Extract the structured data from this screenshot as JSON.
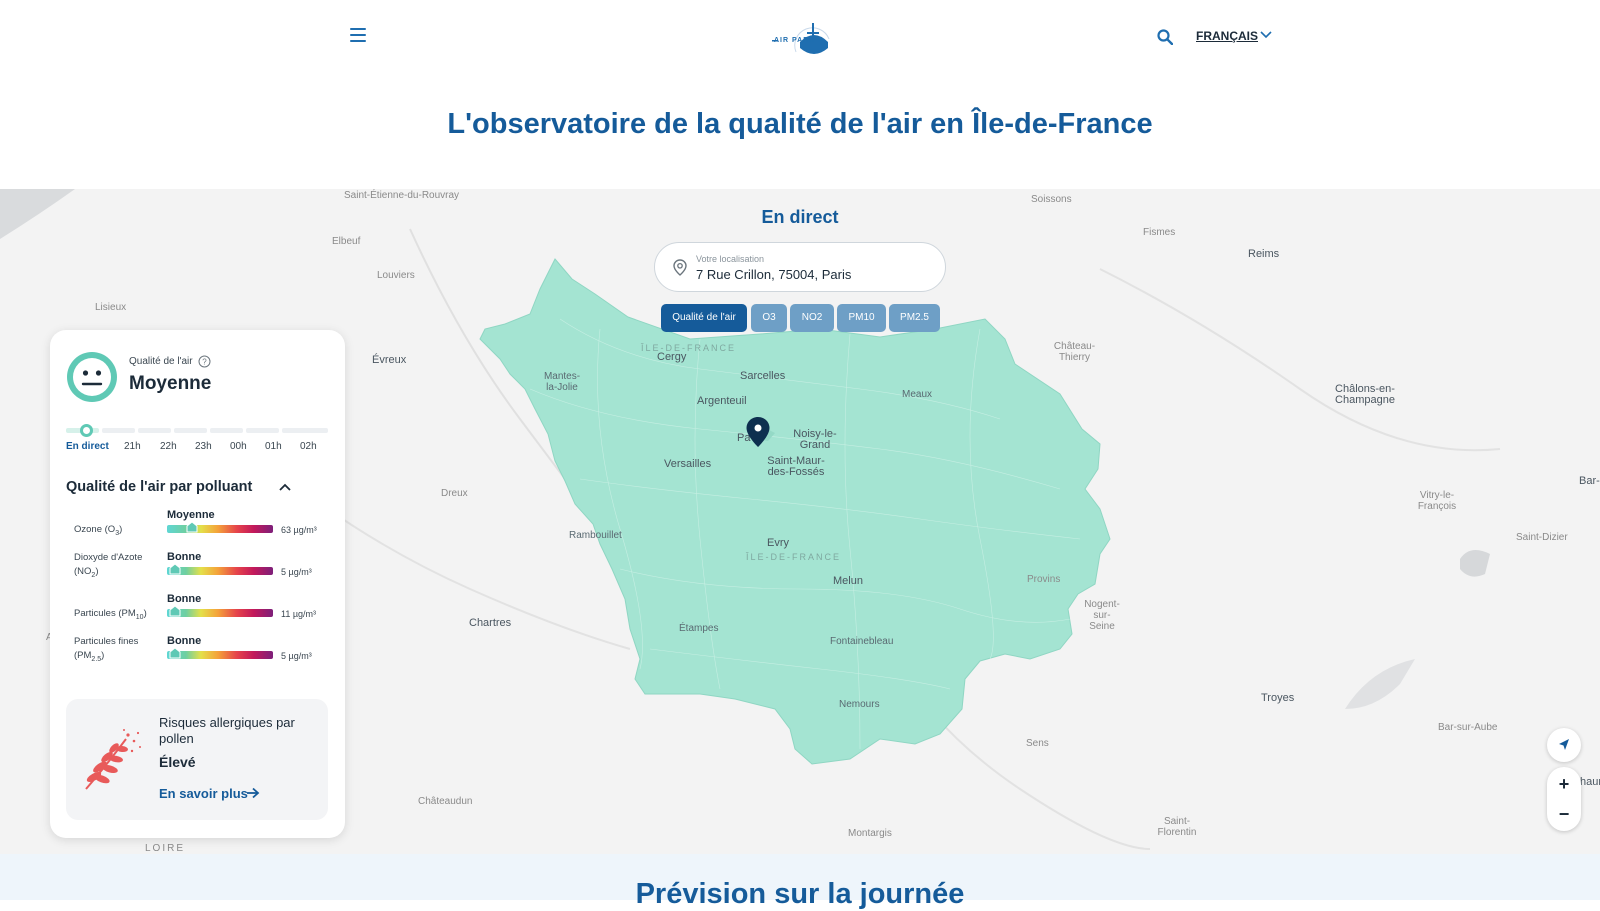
{
  "header": {
    "menu_icon": "hamburger-icon",
    "logo_text": "AIR PARIF",
    "search_icon": "search-icon",
    "language": "FRANÇAIS"
  },
  "page_title": "L'observatoire de la qualité de l'air en Île-de-France",
  "map": {
    "title": "En direct",
    "location": {
      "label": "Votre localisation",
      "value": "7 Rue Crillon, 75004, Paris"
    },
    "tabs": [
      {
        "label": "Qualité de l'air",
        "active": true
      },
      {
        "label": "O3",
        "active": false
      },
      {
        "label": "NO2",
        "active": false
      },
      {
        "label": "PM10",
        "active": false
      },
      {
        "label": "PM2.5",
        "active": false
      }
    ],
    "fill_color": "#9fe3d0",
    "marker_color": "#0d2f4f",
    "cities": [
      "Saint-Étienne-du-Rouvray",
      "Elbeuf",
      "Louviers",
      "Lisieux",
      "Évreux",
      "Dreux",
      "Chartres",
      "Châteaudun",
      "Soissons",
      "Fismes",
      "Reims",
      "Château-Thierry",
      "Châlons-en-Champagne",
      "Vitry-le-François",
      "Saint-Dizier",
      "Bar-",
      "Troyes",
      "Bar-sur-Aube",
      "Sens",
      "Montargis",
      "Saint-Florentin",
      "Nogent-sur-Seine",
      "Provins",
      "Mantes-la-Jolie",
      "Cergy",
      "Sarcelles",
      "Argenteuil",
      "Meaux",
      "Pa",
      "Noisy-le-Grand",
      "Versailles",
      "Saint-Maur-des-Fossés",
      "Rambouillet",
      "Evry",
      "Melun",
      "Étampes",
      "Fontainebleau",
      "Nemours",
      "LOIRE",
      "A",
      "haum"
    ],
    "region_labels": [
      "ÎLE-DE-FRANCE",
      "ÎLE-DE-FRANCE"
    ],
    "controls": {
      "geolocate_icon": "navigation-arrow-icon",
      "zoom_in": "+",
      "zoom_out": "−"
    }
  },
  "card": {
    "aq_label": "Qualité de l'air",
    "aq_value": "Moyenne",
    "face_icon": "neutral-face-icon",
    "face_color": "#5fc9b5",
    "timeline": [
      "En direct",
      "21h",
      "22h",
      "23h",
      "00h",
      "01h",
      "02h"
    ],
    "pollutants_header": "Qualité de l'air par polluant",
    "pollutants": [
      {
        "name": "Ozone (O",
        "sub": "3",
        "name_after": ")",
        "level": "Moyenne",
        "value": "63 µg/m³",
        "index": 0.24
      },
      {
        "name": "Dioxyde d'Azote (NO",
        "sub": "2",
        "name_after": ")",
        "level": "Bonne",
        "value": "5 µg/m³",
        "index": 0.08
      },
      {
        "name": "Particules (PM",
        "sub": "10",
        "name_after": ")",
        "level": "Bonne",
        "value": "11 µg/m³",
        "index": 0.08
      },
      {
        "name": "Particules fines (PM",
        "sub": "2.5",
        "name_after": ")",
        "level": "Bonne",
        "value": "5 µg/m³",
        "index": 0.08
      }
    ],
    "pollen": {
      "title": "Risques allergiques par pollen",
      "level": "Élevé",
      "link": "En savoir plus",
      "icon": "pollen-branch-icon",
      "icon_color": "#e85a5a"
    }
  },
  "bottom_title": "Prévision sur la journée",
  "colors": {
    "primary": "#155b9a",
    "tab_inactive": "#6e9fc6",
    "good": "#5fc9b5"
  }
}
